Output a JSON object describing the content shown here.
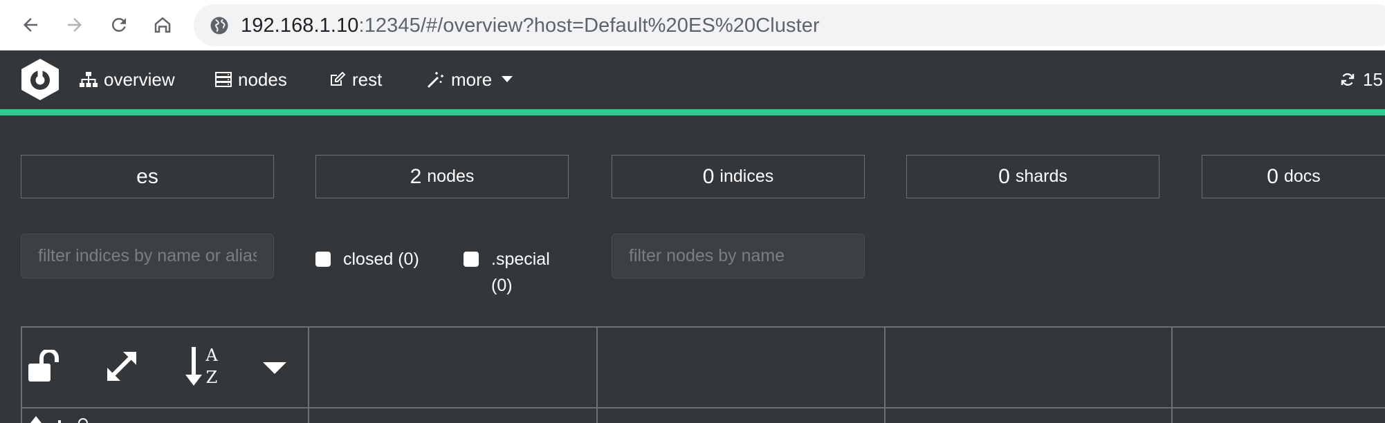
{
  "browser": {
    "url_host": "192.168.1.10",
    "url_rest": ":12345/#/overview?host=Default%20ES%20Cluster",
    "buttons": [
      "back",
      "forward",
      "reload",
      "home"
    ]
  },
  "nav": {
    "items": [
      {
        "label": "overview",
        "icon": "sitemap-icon"
      },
      {
        "label": "nodes",
        "icon": "server-icon"
      },
      {
        "label": "rest",
        "icon": "edit-icon"
      },
      {
        "label": "more",
        "icon": "magic-wand-icon"
      }
    ],
    "refresh_label": "15",
    "accent_color": "#2ecc8f"
  },
  "stats": {
    "cluster_name": "es",
    "nodes_count": "2",
    "nodes_unit": "nodes",
    "indices_count": "0",
    "indices_unit": "indices",
    "shards_count": "0",
    "shards_unit": "shards",
    "docs_count": "0",
    "docs_unit": "docs"
  },
  "filters": {
    "indices_placeholder": "filter indices by name or aliases",
    "closed_label": "closed (0)",
    "special_label": ".special",
    "special_count": "(0)",
    "nodes_placeholder": "filter nodes by name"
  },
  "toolbar": {
    "icons": [
      "unlock-icon",
      "expand-icon",
      "sort-alpha-icon",
      "caret-down-icon"
    ]
  }
}
